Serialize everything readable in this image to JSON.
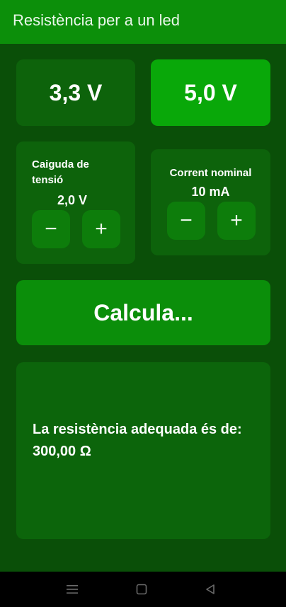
{
  "app": {
    "title": "Resistència per a un led"
  },
  "voltage_buttons": [
    {
      "label": "3,3 V",
      "selected": false
    },
    {
      "label": "5,0 V",
      "selected": true
    }
  ],
  "voltage_drop": {
    "label": "Caiguda de tensió",
    "value": "2,0 V"
  },
  "nominal_current": {
    "label": "Corrent nominal",
    "value": "10 mA"
  },
  "stepper": {
    "minus": "−",
    "plus": "+"
  },
  "calculate": {
    "label": "Calcula..."
  },
  "result": {
    "text": "La resistència adequada és de:",
    "value": "300,00 Ω"
  },
  "colors": {
    "background": "#0a4f08",
    "appbar": "#0c8f0a",
    "selected": "#09a809",
    "card": "#0d630b"
  },
  "navbar": {
    "icons": [
      "menu-icon",
      "home-square-icon",
      "back-triangle-icon"
    ]
  }
}
